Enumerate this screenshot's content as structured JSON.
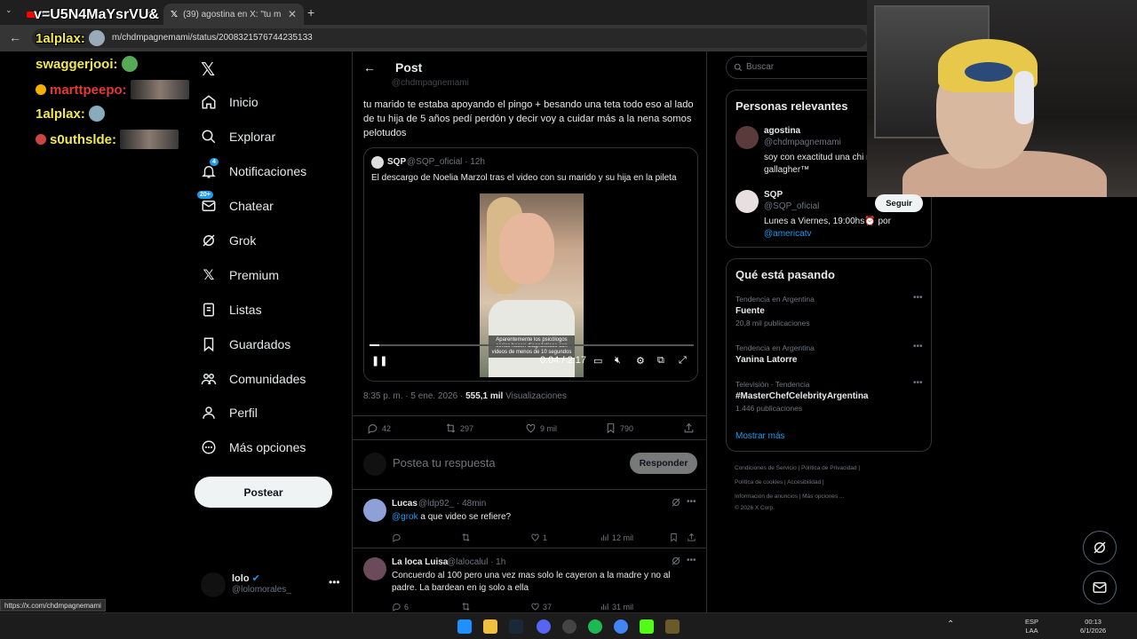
{
  "browser": {
    "tabs": [
      {
        "title": "v=U5N4MaYsrVU&"
      },
      {
        "title": "(39) agostina en X: \"tu marido t"
      }
    ],
    "url": "m/chdmpagnemami/status/2008321576744235133",
    "status_url": "https://x.com/chdmpagnemami"
  },
  "stream_chat": [
    {
      "user": "1alplax:",
      "color": "#f2e94e"
    },
    {
      "user": "swaggerjooi:",
      "color": "#f2e94e"
    },
    {
      "user": "marttpeepo:",
      "color": "#e53935"
    },
    {
      "user": "1alplax:",
      "color": "#f2e94e"
    },
    {
      "user": "s0uthslde:",
      "color": "#f2e94e"
    }
  ],
  "nav": {
    "items": [
      {
        "label": "Inicio",
        "icon": "home-icon"
      },
      {
        "label": "Explorar",
        "icon": "search-icon"
      },
      {
        "label": "Notificaciones",
        "icon": "bell-icon",
        "badge": "4"
      },
      {
        "label": "Chatear",
        "icon": "mail-icon",
        "badge": "20+"
      },
      {
        "label": "Grok",
        "icon": "grok-icon"
      },
      {
        "label": "Premium",
        "icon": "x-icon"
      },
      {
        "label": "Listas",
        "icon": "list-icon"
      },
      {
        "label": "Guardados",
        "icon": "bookmark-icon"
      },
      {
        "label": "Comunidades",
        "icon": "people-icon"
      },
      {
        "label": "Perfil",
        "icon": "person-icon"
      },
      {
        "label": "Más opciones",
        "icon": "more-icon"
      }
    ],
    "post_button": "Postear",
    "account": {
      "name": "lolo",
      "handle": "@lolomorales_"
    }
  },
  "post": {
    "header_title": "Post",
    "faded_handle": "@chdmpagnemami",
    "text": "tu marido te estaba apoyando el pingo + besando una teta todo eso al lado de tu hija de 5 años pedí perdón y decir voy a cuidar más a la nena somos pelotudos",
    "quote": {
      "name": "SQP",
      "handle": "@SQP_oficial · 12h",
      "text": "El descargo de Noelia Marzol tras el video con su marido y su hija en la pileta",
      "video_caption": "Aparentemente los psicólogos serios hacen diagnósticos con videos de menos de 10 segundos",
      "time": "0:04 / 2:17",
      "progress": 0.03
    },
    "meta_time": "8:35 p. m. · 5 ene. 2026 · ",
    "meta_views": "555,1 mil",
    "meta_views_label": " Visualizaciones",
    "stats": {
      "replies": "42",
      "reposts": "297",
      "likes": "9 mil",
      "bookmarks": "790"
    },
    "reply_placeholder": "Postea tu respuesta",
    "reply_button": "Responder"
  },
  "replies": [
    {
      "name": "Lucas",
      "handle": "@ldp92_ · 48min",
      "mention": "@grok",
      "text": " a que video se refiere?",
      "likes": "1",
      "views": "12 mil",
      "avatar_color": "#8fa0d8"
    },
    {
      "name": "La loca Luisa",
      "handle": "@lalocalul · 1h",
      "mention": "",
      "text": "Concuerdo al 100 pero una vez mas solo le cayeron a la madre y no al padre. La bardean en ig solo a ella",
      "replies": "6",
      "likes": "37",
      "views": "31 mil",
      "avatar_color": "#6b4a5a"
    }
  ],
  "right": {
    "search_placeholder": "Buscar",
    "relevant_title": "Personas relevantes",
    "people": [
      {
        "name": "agostina",
        "handle": "@chdmpagnemami",
        "bio": "soy con exactitud una chi nena de noel gallagher™",
        "bio_link": ""
      },
      {
        "name": "SQP",
        "handle": "@SQP_oficial",
        "bio": "Lunes a Viernes, 19:00hs⏰ por ",
        "bio_link": "@americatv"
      }
    ],
    "follow_label": "Seguir",
    "trends_title": "Qué está pasando",
    "trends": [
      {
        "context": "Tendencia en Argentina",
        "title": "Fuente",
        "count": "20,8 mil publicaciones"
      },
      {
        "context": "Tendencia en Argentina",
        "title": "Yanina Latorre",
        "count": ""
      },
      {
        "context": "Televisión · Tendencia",
        "title": "#MasterChefCelebrityArgentina",
        "count": "1.446 publicaciones"
      }
    ],
    "show_more": "Mostrar más",
    "footer": [
      "Condiciones de Servicio  |  Política de Privacidad  |",
      "Política de cookies  |  Accesibilidad  |",
      "Información de anuncios  |  Más opciones ...",
      "© 2026 X Corp."
    ]
  },
  "taskbar": {
    "lang": "ESP",
    "lang2": "LAA",
    "time": "00:13",
    "date": "6/1/2026"
  }
}
